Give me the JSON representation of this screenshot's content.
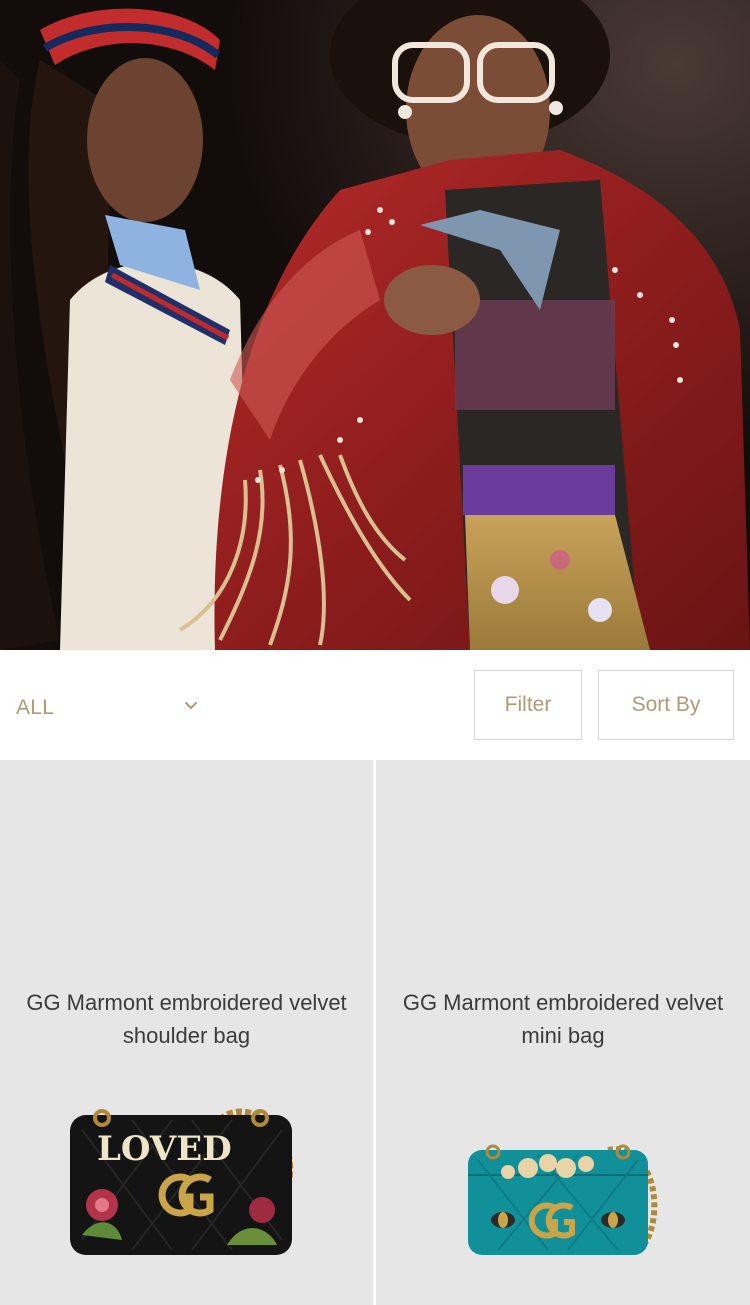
{
  "hero": {
    "image_name": "fashion-campaign-photo"
  },
  "toolbar": {
    "category_value": "ALL",
    "chevron_icon": "chevron-down-icon",
    "filter_label": "Filter",
    "sort_label": "Sort By"
  },
  "products": [
    {
      "title": "GG Marmont embroidered velvet shoulder bag",
      "image_icon": "black-velvet-shoulder-bag",
      "color": "#141414"
    },
    {
      "title": "GG Marmont embroidered velvet mini bag",
      "image_icon": "teal-velvet-mini-bag",
      "color": "#11909a"
    }
  ],
  "colors": {
    "accent_gold": "#b19a73",
    "card_background": "#e6e6e6",
    "text_dark": "#3b3b3b"
  }
}
